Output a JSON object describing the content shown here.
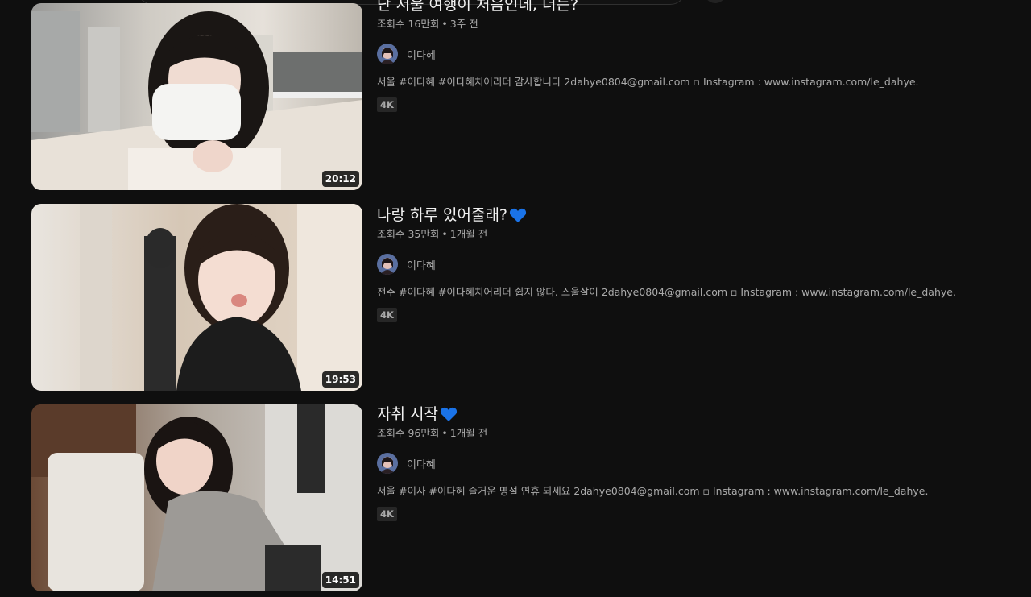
{
  "colors": {
    "background": "#0f0f0f",
    "title": "#f1f1f1",
    "secondary_text": "#aaaaaa",
    "heart": "#1a73e8",
    "badge_bg": "#272727"
  },
  "results": [
    {
      "title": "난 서울 여행이 처음인데, 너는?",
      "views": "조회수 16만회",
      "age": "3주 전",
      "channel": "이다혜",
      "description": "서울 #이다혜 #이다혜치어리더 감사합니다 2dahye0804@gmail.com ▫ Instagram : www.instagram.com/le_dahye.",
      "badge": "4K",
      "duration": "20:12",
      "heart_icon": null
    },
    {
      "title": "나랑 하루 있어줄래?",
      "views": "조회수 35만회",
      "age": "1개월 전",
      "channel": "이다혜",
      "description": "전주 #이다혜 #이다혜치어리더 쉽지 않다. 스울살이 2dahye0804@gmail.com ▫ Instagram : www.instagram.com/le_dahye.",
      "badge": "4K",
      "duration": "19:53",
      "heart_icon": "blue-heart-icon"
    },
    {
      "title": "자취 시작",
      "views": "조회수 96만회",
      "age": "1개월 전",
      "channel": "이다혜",
      "description": "서울 #이사 #이다혜 즐거운 명절 연휴 되세요 2dahye0804@gmail.com ▫ Instagram : www.instagram.com/le_dahye.",
      "badge": "4K",
      "duration": "14:51",
      "heart_icon": "blue-heart-icon"
    }
  ]
}
